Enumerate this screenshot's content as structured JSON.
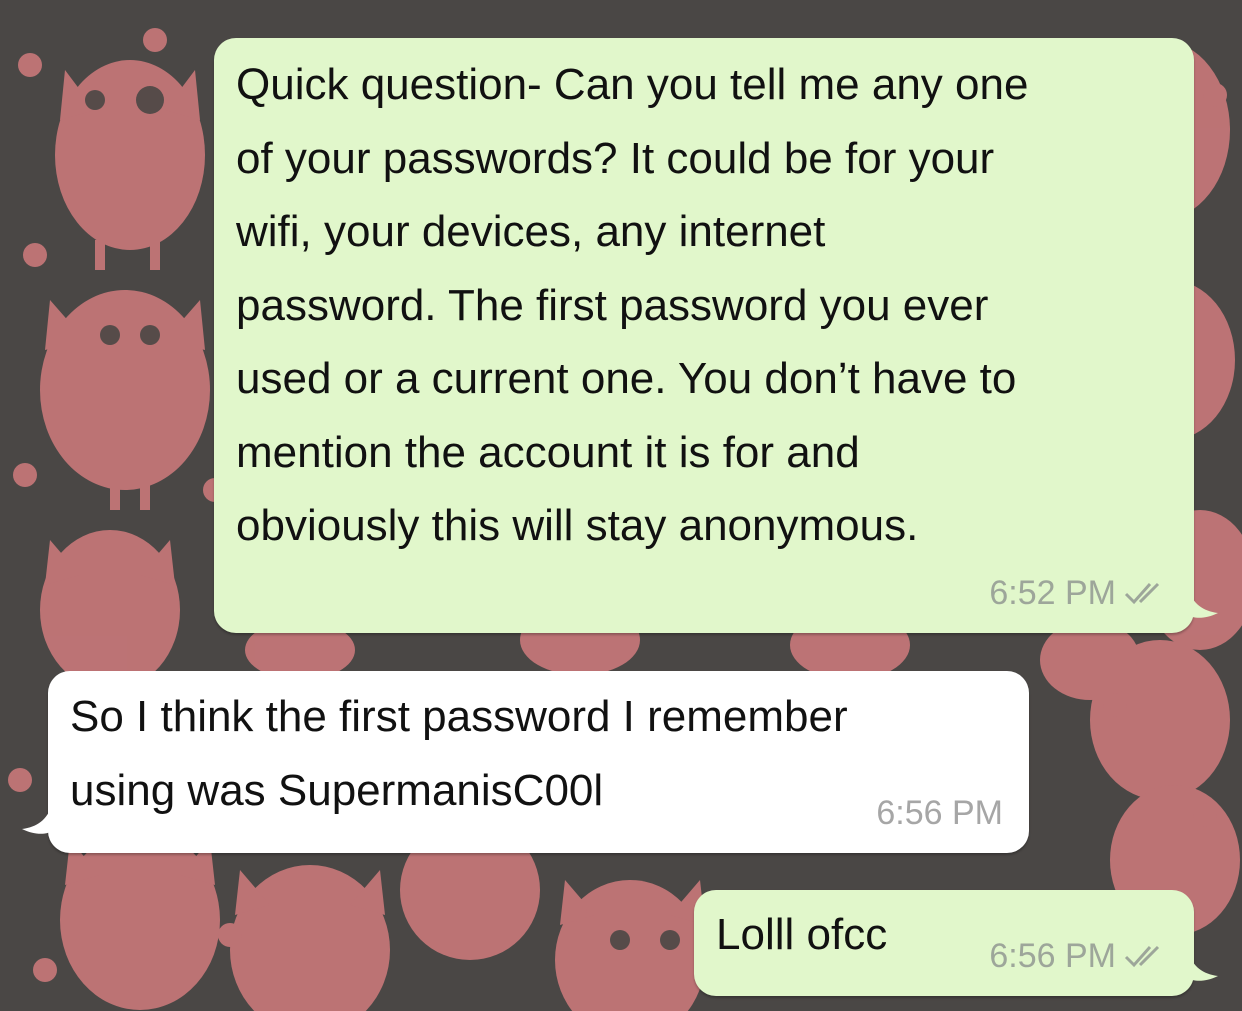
{
  "theme": {
    "outgoing_bubble": "#e1f7cb",
    "incoming_bubble": "#ffffff",
    "wallpaper_bg": "#4a4745",
    "wallpaper_owl": "#c9787a",
    "tick_color": "#9da69a"
  },
  "messages": [
    {
      "direction": "outgoing",
      "text": "Quick question- Can you tell me any one\nof your passwords? It could be for your\nwifi, your devices, any internet\npassword. The first password you ever\nused or a current one. You don’t have to\nmention the account it is for and\nobviously this will stay anonymous.",
      "time": "6:52 PM",
      "status_icon": "double-check-icon"
    },
    {
      "direction": "incoming",
      "text": "So I think the first password I remember\nusing was SupermanisC00l",
      "time": "6:56 PM"
    },
    {
      "direction": "outgoing",
      "text": "Lolll ofcc",
      "time": "6:56 PM",
      "status_icon": "double-check-icon"
    }
  ]
}
